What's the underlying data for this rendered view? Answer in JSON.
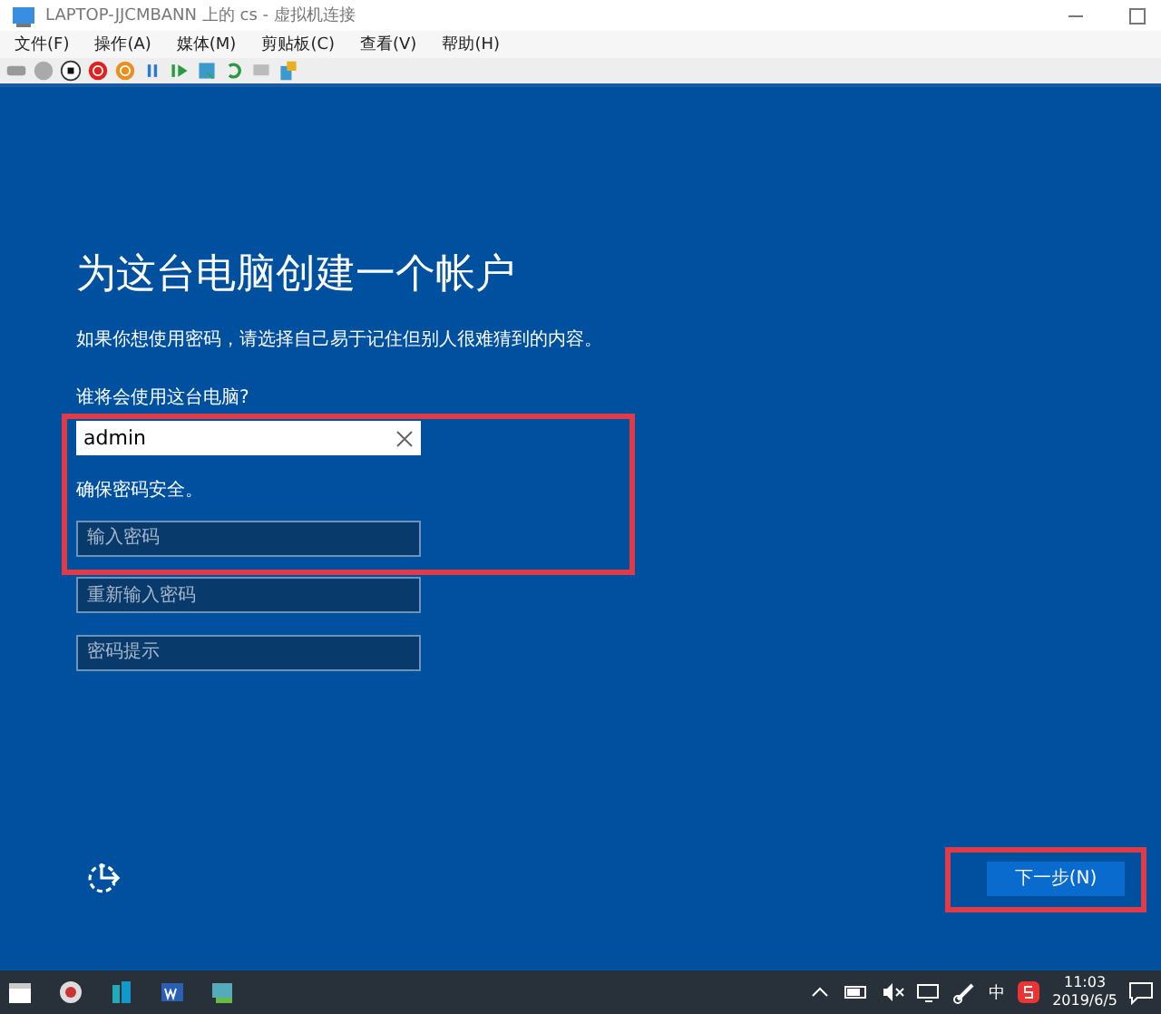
{
  "window": {
    "title": "LAPTOP-JJCMBANN 上的 cs - 虚拟机连接"
  },
  "menu": [
    "文件(F)",
    "操作(A)",
    "媒体(M)",
    "剪贴板(C)",
    "查看(V)",
    "帮助(H)"
  ],
  "setup": {
    "heading": "为这台电脑创建一个帐户",
    "description": "如果你想使用密码，请选择自己易于记住但别人很难猜到的内容。",
    "user_label": "谁将会使用这台电脑?",
    "username": "admin",
    "password_label": "确保密码安全。",
    "fields": [
      {
        "placeholder": "输入密码"
      },
      {
        "placeholder": "重新输入密码"
      },
      {
        "placeholder": "密码提示"
      }
    ],
    "next_button": "下一步(N)"
  },
  "tray": {
    "ime": "中",
    "time": "11:03",
    "date": "2019/6/5"
  }
}
